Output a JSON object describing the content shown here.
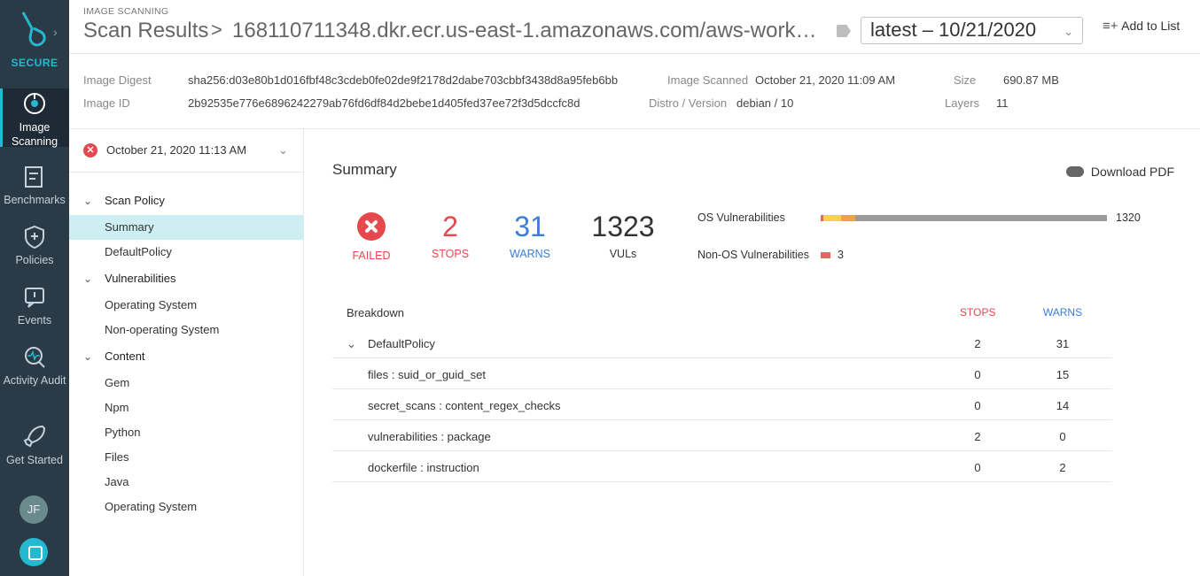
{
  "nav": {
    "brand": "SECURE",
    "items": [
      {
        "label": "Image Scanning",
        "line1": "Image",
        "line2": "Scanning"
      },
      {
        "label": "Benchmarks"
      },
      {
        "label": "Policies"
      },
      {
        "label": "Events"
      },
      {
        "label": "Activity Audit"
      },
      {
        "label": "Get Started"
      }
    ],
    "avatar_initials": "JF"
  },
  "header": {
    "section": "IMAGE SCANNING",
    "title": "Scan Results",
    "separator": ">",
    "repo": "168110711348.dkr.ecr.us-east-1.amazonaws.com/aws-workshop...",
    "tag_value": "latest – 10/21/2020",
    "add_to_list": "Add to List"
  },
  "meta": {
    "digest_label": "Image Digest",
    "digest": "sha256:d03e80b1d016fbf48c3cdeb0fe02de9f2178d2dabe703cbbf3438d8a95feb6bb",
    "id_label": "Image ID",
    "id": "2b92535e776e6896242279ab76fd6df84d2bebe1d405fed37ee72f3d5dccfc8d",
    "scanned_label": "Image Scanned",
    "scanned": "October 21, 2020 11:09 AM",
    "distro_label": "Distro / Version",
    "distro": "debian / 10",
    "size_label": "Size",
    "size": "690.87 MB",
    "layers_label": "Layers",
    "layers": "11"
  },
  "side": {
    "scan_date": "October 21, 2020 11:13 AM",
    "groups": {
      "scan_policy": "Scan Policy",
      "summary": "Summary",
      "default_policy": "DefaultPolicy",
      "vulnerabilities": "Vulnerabilities",
      "operating_system": "Operating System",
      "non_operating_system": "Non-operating System",
      "content": "Content",
      "gem": "Gem",
      "npm": "Npm",
      "python": "Python",
      "files": "Files",
      "java": "Java",
      "content_os": "Operating System"
    }
  },
  "summary": {
    "title": "Summary",
    "download_pdf": "Download PDF",
    "failed_label": "FAILED",
    "stops_value": "2",
    "stops_label": "STOPS",
    "warns_value": "31",
    "warns_label": "WARNS",
    "vuls_value": "1323",
    "vuls_label": "VULs",
    "os_vuln_label": "OS Vulnerabilities",
    "os_vuln_count": "1320",
    "nonos_vuln_label": "Non-OS Vulnerabilities",
    "nonos_vuln_count": "3",
    "colors": {
      "failed": "#e5484d",
      "stops": "#e5484d",
      "warns": "#3b7dd8",
      "os_high": "#e76464",
      "os_medium": "#f5d547",
      "os_low": "#f2a341",
      "os_neg": "#9b9b9b"
    }
  },
  "breakdown": {
    "header": "Breakdown",
    "stops_header": "STOPS",
    "warns_header": "WARNS",
    "policy": {
      "name": "DefaultPolicy",
      "stops": "2",
      "warns": "31"
    },
    "rows": [
      {
        "name": "files : suid_or_guid_set",
        "stops": "0",
        "warns": "15"
      },
      {
        "name": "secret_scans : content_regex_checks",
        "stops": "0",
        "warns": "14"
      },
      {
        "name": "vulnerabilities : package",
        "stops": "2",
        "warns": "0"
      },
      {
        "name": "dockerfile : instruction",
        "stops": "0",
        "warns": "2"
      }
    ]
  }
}
